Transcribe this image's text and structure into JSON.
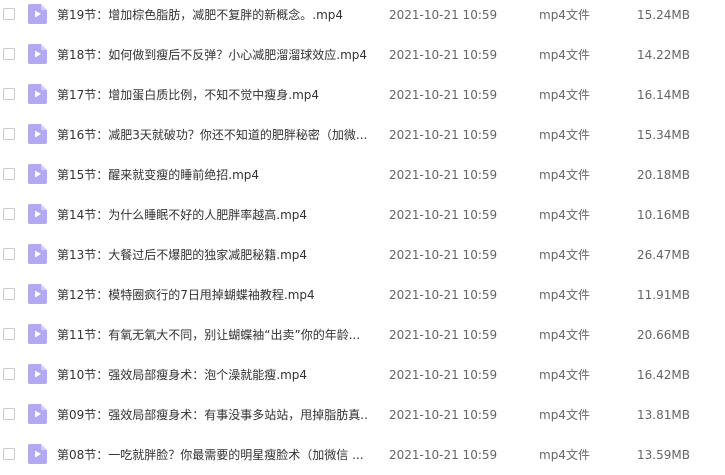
{
  "files": [
    {
      "name": "第19节：增加棕色脂肪，减肥不复胖的新概念。.mp4",
      "date": "2021-10-21 10:59",
      "type": "mp4文件",
      "size": "15.24MB",
      "icon": "video-file-icon"
    },
    {
      "name": "第18节：如何做到瘦后不反弹？小心减肥溜溜球效应.mp4",
      "date": "2021-10-21 10:59",
      "type": "mp4文件",
      "size": "14.22MB",
      "icon": "video-file-icon"
    },
    {
      "name": "第17节：增加蛋白质比例，不知不觉中瘦身.mp4",
      "date": "2021-10-21 10:59",
      "type": "mp4文件",
      "size": "16.14MB",
      "icon": "video-file-icon"
    },
    {
      "name": "第16节：减肥3天就破功？你还不知道的肥胖秘密（加微...",
      "date": "2021-10-21 10:59",
      "type": "mp4文件",
      "size": "15.34MB",
      "icon": "video-file-icon"
    },
    {
      "name": "第15节：醒来就变瘦的睡前绝招.mp4",
      "date": "2021-10-21 10:59",
      "type": "mp4文件",
      "size": "20.18MB",
      "icon": "video-file-icon"
    },
    {
      "name": "第14节：为什么睡眠不好的人肥胖率越高.mp4",
      "date": "2021-10-21 10:59",
      "type": "mp4文件",
      "size": "10.16MB",
      "icon": "video-file-icon"
    },
    {
      "name": "第13节：大餐过后不爆肥的独家减肥秘籍.mp4",
      "date": "2021-10-21 10:59",
      "type": "mp4文件",
      "size": "26.47MB",
      "icon": "video-file-icon"
    },
    {
      "name": "第12节：模特圈疯行的7日甩掉蝴蝶袖教程.mp4",
      "date": "2021-10-21 10:59",
      "type": "mp4文件",
      "size": "11.91MB",
      "icon": "video-file-icon"
    },
    {
      "name": "第11节：有氧无氧大不同，别让蝴蝶袖“出卖”你的年龄...",
      "date": "2021-10-21 10:59",
      "type": "mp4文件",
      "size": "20.66MB",
      "icon": "video-file-icon"
    },
    {
      "name": "第10节：强效局部瘦身术：泡个澡就能瘦.mp4",
      "date": "2021-10-21 10:59",
      "type": "mp4文件",
      "size": "16.42MB",
      "icon": "video-file-icon"
    },
    {
      "name": "第09节：强效局部瘦身术：有事没事多站站，甩掉脂肪真...",
      "date": "2021-10-21 10:59",
      "type": "mp4文件",
      "size": "13.81MB",
      "icon": "video-file-icon"
    },
    {
      "name": "第08节：一吃就胖脸？你最需要的明星瘦脸术（加微信 ...",
      "date": "2021-10-21 10:59",
      "type": "mp4文件",
      "size": "13.59MB",
      "icon": "video-file-icon"
    }
  ],
  "colors": {
    "icon_fill": "#b2a9f2",
    "icon_fold": "#d6d1fa",
    "icon_play": "#ffffff",
    "name_text": "#333333",
    "meta_text": "#666666"
  }
}
